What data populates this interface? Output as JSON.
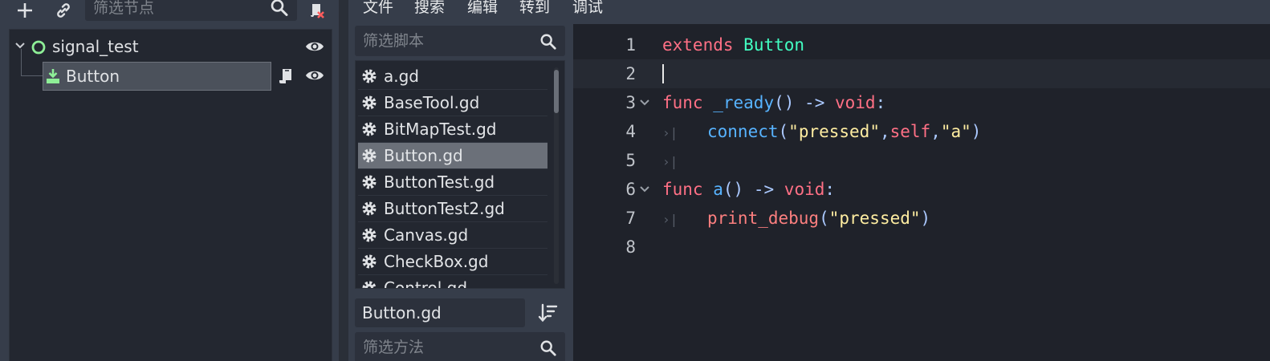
{
  "scene_dock": {
    "filter_placeholder": "筛选节点",
    "tree": {
      "root_label": "signal_test",
      "child_label": "Button"
    }
  },
  "menu": [
    "文件",
    "搜索",
    "编辑",
    "转到",
    "调试"
  ],
  "script_panel": {
    "filter_placeholder": "筛选脚本",
    "scripts": [
      {
        "name": "a.gd",
        "selected": false
      },
      {
        "name": "BaseTool.gd",
        "selected": false
      },
      {
        "name": "BitMapTest.gd",
        "selected": false
      },
      {
        "name": "Button.gd",
        "selected": true
      },
      {
        "name": "ButtonTest.gd",
        "selected": false
      },
      {
        "name": "ButtonTest2.gd",
        "selected": false
      },
      {
        "name": "Canvas.gd",
        "selected": false
      },
      {
        "name": "CheckBox.gd",
        "selected": false
      },
      {
        "name": "Control.gd",
        "selected": false
      }
    ],
    "current_script": "Button.gd",
    "method_filter_placeholder": "筛选方法"
  },
  "editor": {
    "line_numbers": [
      "1",
      "2",
      "3",
      "4",
      "5",
      "6",
      "7",
      "8"
    ],
    "current_line": 2,
    "code": {
      "l1_kw": "extends",
      "l1_type": "Button",
      "l3_kw": "func",
      "l3_name": "_ready",
      "l3_parens": "()",
      "l3_arrow": "->",
      "l3_ret": "void",
      "l3_colon": ":",
      "l4_fn": "connect",
      "l4_open": "(",
      "l4_str1": "\"pressed\"",
      "l4_comma1": ",",
      "l4_self": "self",
      "l4_comma2": ",",
      "l4_str2": "\"a\"",
      "l4_close": ")",
      "l6_kw": "func",
      "l6_name": "a",
      "l6_parens": "()",
      "l6_arrow": "->",
      "l6_ret": "void",
      "l6_colon": ":",
      "l7_fn": "print_debug",
      "l7_open": "(",
      "l7_str": "\"pressed\"",
      "l7_close": ")"
    }
  },
  "colors": {
    "keyword": "#ff7085",
    "type": "#42ffc2",
    "function": "#57b3ff",
    "symbol": "#abc9ff",
    "string": "#ffeda1",
    "builtin_func": "#fc7f7f",
    "node_icon": "#8eef97"
  },
  "icons": [
    "add-icon",
    "link-icon",
    "search-icon",
    "clear-script-icon",
    "collapse-icon",
    "node-icon",
    "button-node-icon",
    "visibility-icon",
    "script-icon",
    "gear-icon",
    "sort-icon",
    "fold-icon",
    "tab-indent-icon"
  ]
}
